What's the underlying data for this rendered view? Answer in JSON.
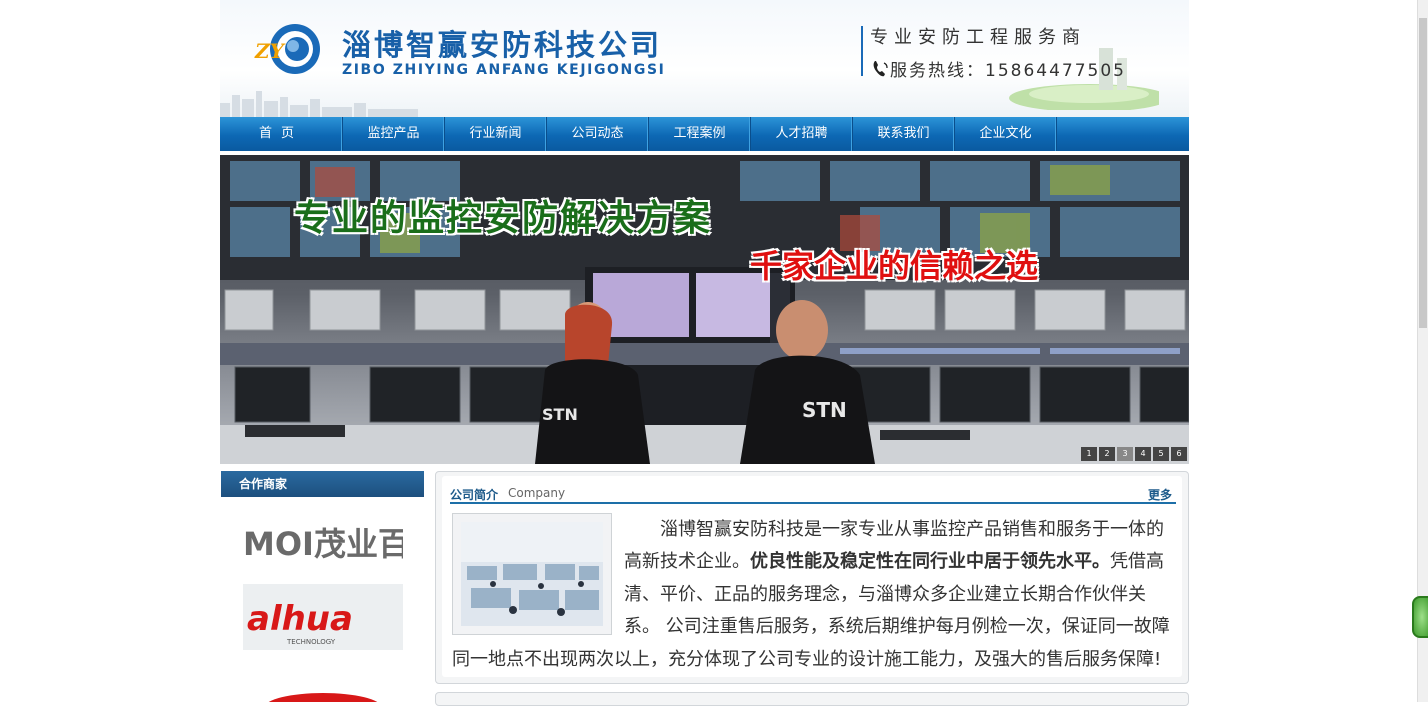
{
  "header": {
    "logo_text": "ZY",
    "company_name": "淄博智赢安防科技公司",
    "company_name_en": "ZIBO ZHIYING ANFANG KEJIGONGSI",
    "tagline": "专业安防工程服务商",
    "hotline_label": "服务热线：",
    "hotline_number": "15864477505"
  },
  "nav": {
    "items": [
      "首页",
      "监控产品",
      "行业新闻",
      "公司动态",
      "工程案例",
      "人才招聘",
      "联系我们",
      "企业文化"
    ]
  },
  "banner": {
    "headline": "专业的监控安防解决方案",
    "subheadline": "千家企业的信赖之选",
    "shirt_text": "STN",
    "slides": [
      "1",
      "2",
      "3",
      "4",
      "5",
      "6"
    ],
    "active_slide": "3"
  },
  "partners": {
    "title": "合作商家",
    "logo1": "MOI茂业百货",
    "logo2_main": "alhua",
    "logo2_sub": "TECHNOLOGY"
  },
  "company": {
    "title": "公司简介",
    "subtitle": "Company",
    "more_label": "更多",
    "intro_part1": "淄博智赢安防科技是一家专业从事监控产品销售和服务于一体的高新技术企业。",
    "intro_bold": "优良性能及稳定性在同行业中居于领先水平。",
    "intro_part2": "凭借高清、平价、正品的服务理念，与淄博众多企业建立长期合作伙伴关系。 公司注重售后服务，系统后期维护每月例检一次，保证同一故障同一地点不出现两次以上，充分体现了公司专业的设计施工能力，及强大的售后服务保障!"
  },
  "colors": {
    "brand_blue": "#1860a8",
    "nav_blue": "#0d68b4",
    "headline_green": "#1a6e1a",
    "subheadline_red": "#e01010"
  }
}
